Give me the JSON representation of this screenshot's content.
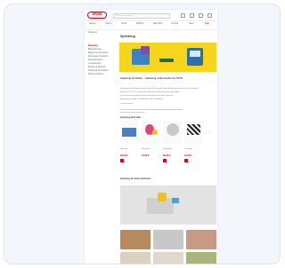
{
  "brand": {
    "logo_text": "otto",
    "color": "#e3000f"
  },
  "header": {
    "search_placeholder": "Wonach suchst du?",
    "icons": [
      "service-icon",
      "user-icon",
      "wishlist-icon",
      "cart-icon"
    ]
  },
  "nav": {
    "items": [
      "Damen",
      "Herren",
      "Kinder",
      "Wohnen",
      "Baumarkt",
      "Technik",
      "Sport",
      "Sale"
    ]
  },
  "breadcrumb": "Spielzeug",
  "page": {
    "title": "Spielzeug",
    "intro_heading": "Spielzeug für Kinder – Spielzeug online kaufen bei OTTO",
    "intro_lines": [
      "Spielzeug ist für Kinder mehr als nur Zeitvertreib: Beim Spielen lernen sie die Welt kennen.",
      "Entdecke bei OTTO eine große Auswahl an Spielzeug für jedes Alter.",
      "Spielzeug für Babys, Kleinkinder und Schulkinder"
    ],
    "section_heading": "Spielzeug-Bestseller",
    "promo_heading": "Spielzeug für kleine Entdecker"
  },
  "sidebar": {
    "heading": "Spielzeug",
    "items": [
      "Babyspielzeug",
      "Bauen & Konstruieren",
      "Fahrzeuge & Zubehör",
      "Kinderspielzeug",
      "Lernspielzeug",
      "Puppen & Zubehör",
      "Spielzeug für draußen",
      "Spiele & Puzzles"
    ]
  },
  "products": [
    {
      "name": "Spielset",
      "price": "29,99 €"
    },
    {
      "name": "Plüschtier",
      "price": "19,99 €"
    },
    {
      "name": "Babywippe",
      "price": "89,99 €"
    },
    {
      "name": "Lernspiel",
      "price": "24,99 €"
    }
  ]
}
